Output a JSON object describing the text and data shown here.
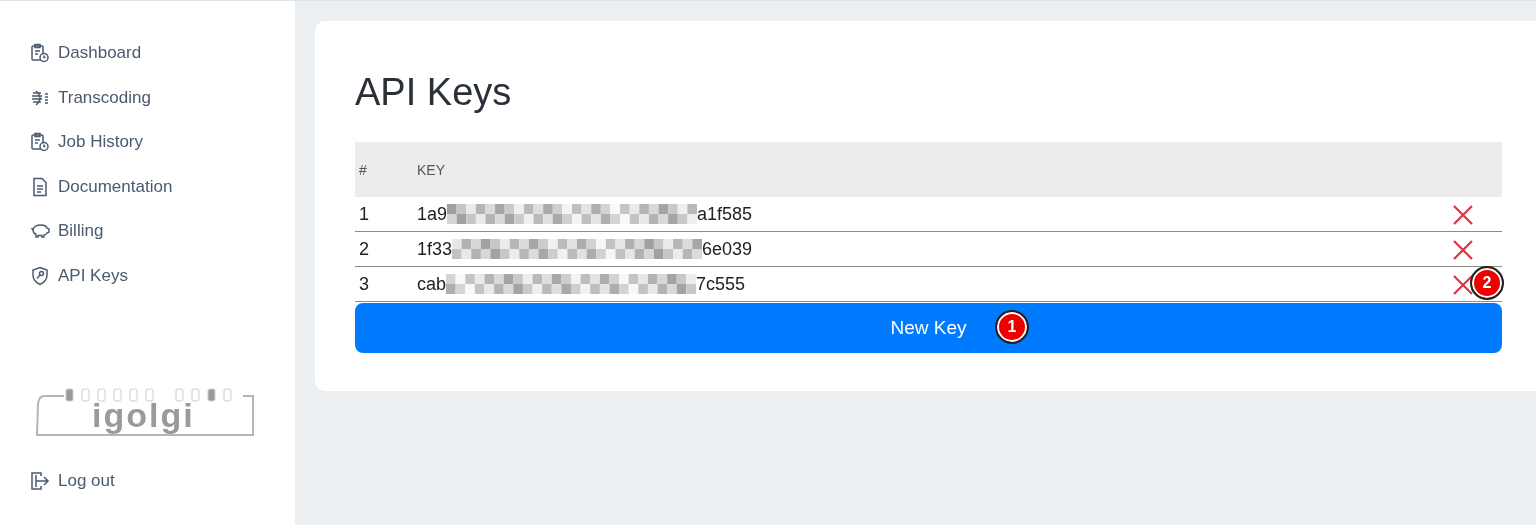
{
  "sidebar": {
    "items": [
      {
        "label": "Dashboard"
      },
      {
        "label": "Transcoding"
      },
      {
        "label": "Job History"
      },
      {
        "label": "Documentation"
      },
      {
        "label": "Billing"
      },
      {
        "label": "API Keys"
      }
    ],
    "logo": "igolgi",
    "logout": "Log out"
  },
  "page": {
    "title": "API Keys",
    "table": {
      "columns": [
        "#",
        "KEY"
      ],
      "rows": [
        {
          "index": "1",
          "key_start": "1a9",
          "key_end": "a1f585"
        },
        {
          "index": "2",
          "key_start": "1f33",
          "key_end": "6e039"
        },
        {
          "index": "3",
          "key_start": "cab",
          "key_end": "7c555"
        }
      ]
    },
    "new_button": "New Key",
    "markers": [
      "1",
      "2"
    ]
  }
}
